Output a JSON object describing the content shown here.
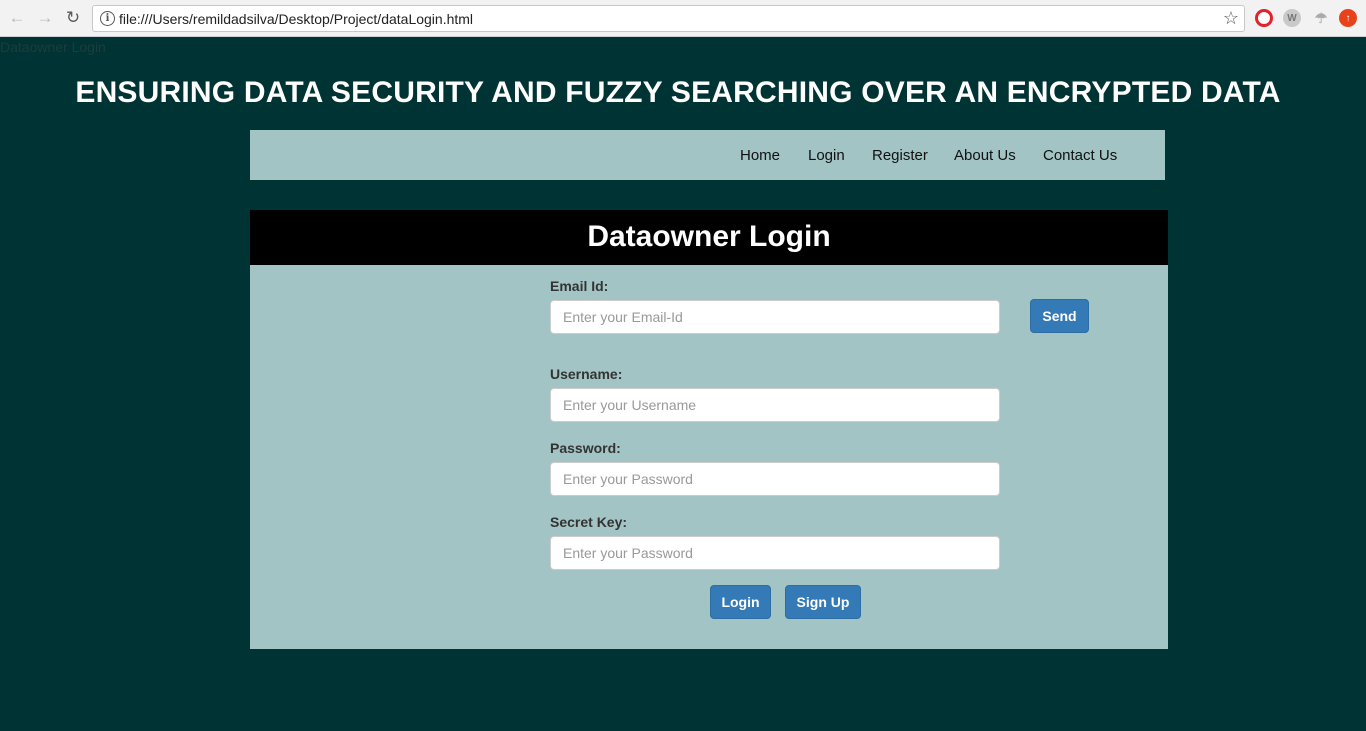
{
  "browser": {
    "url": "file:///Users/remildadsilva/Desktop/Project/dataLogin.html",
    "back_icon": "back-arrow-icon",
    "forward_icon": "forward-arrow-icon",
    "reload_icon": "reload-icon",
    "extensions": [
      "opera-icon",
      "w-extension-icon",
      "umbrella-icon",
      "upload-icon"
    ]
  },
  "page": {
    "tab_title": "Dataowner Login",
    "site_title": "ENSURING DATA SECURITY AND FUZZY SEARCHING OVER AN ENCRYPTED DATA"
  },
  "nav": {
    "items": [
      "Home",
      "Login",
      "Register",
      "About Us",
      "Contact Us"
    ]
  },
  "panel": {
    "title": "Dataowner Login"
  },
  "form": {
    "email": {
      "label": "Email Id:",
      "placeholder": "Enter your Email-Id",
      "value": ""
    },
    "send_label": "Send",
    "username": {
      "label": "Username:",
      "placeholder": "Enter your Username",
      "value": ""
    },
    "password": {
      "label": "Password:",
      "placeholder": "Enter your Password",
      "value": ""
    },
    "secret_key": {
      "label": "Secret Key:",
      "placeholder": "Enter your Password",
      "value": ""
    },
    "login_label": "Login",
    "signup_label": "Sign Up"
  },
  "colors": {
    "page_bg": "#003333",
    "panel_bg": "#a3c4c4",
    "header_bg": "#000000",
    "button": "#337ab7"
  }
}
